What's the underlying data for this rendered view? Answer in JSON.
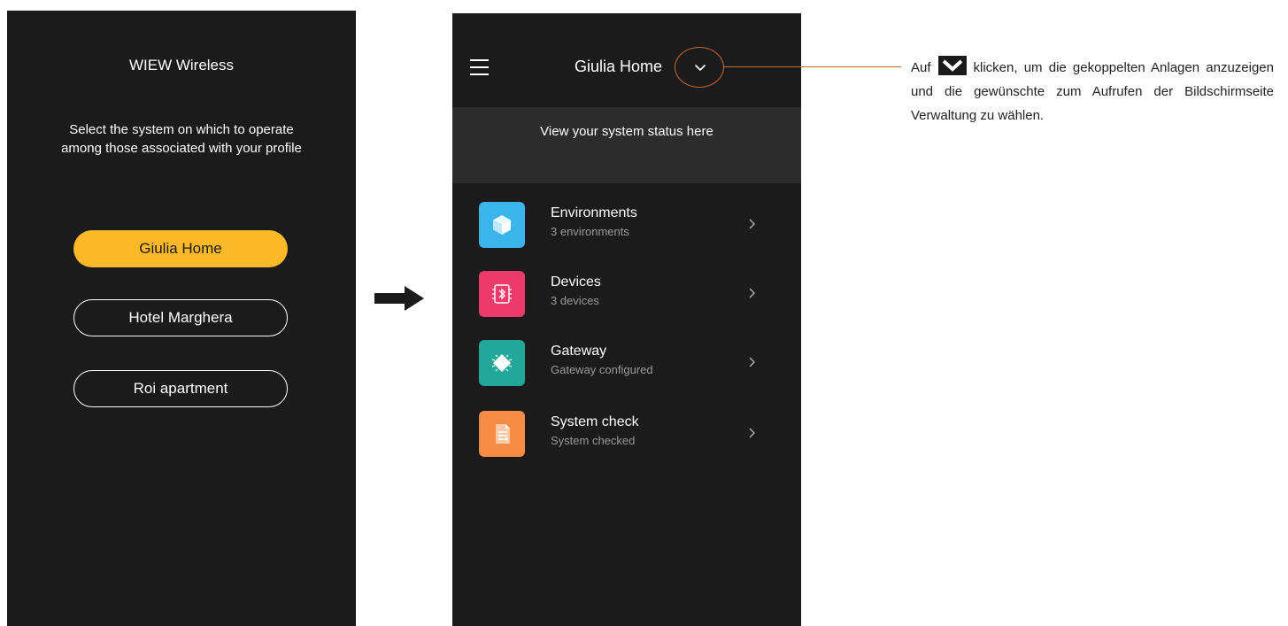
{
  "left_screen": {
    "title": "WIEW Wireless",
    "subtitle_line1": "Select the system on which to operate",
    "subtitle_line2": "among those associated with your profile",
    "systems": [
      {
        "label": "Giulia Home",
        "selected": true
      },
      {
        "label": "Hotel Marghera",
        "selected": false
      },
      {
        "label": "Roi apartment",
        "selected": false
      }
    ]
  },
  "right_screen": {
    "header": {
      "title": "Giulia Home",
      "menu_icon": "hamburger-icon",
      "dropdown_icon": "chevron-down-icon"
    },
    "status_text": "View your system status here",
    "items": [
      {
        "title": "Environments",
        "subtitle": "3 environments",
        "icon": "cube-icon",
        "color": "#3bb4ec"
      },
      {
        "title": "Devices",
        "subtitle": "3 devices",
        "icon": "bluetooth-chip-icon",
        "color": "#ec3b6b"
      },
      {
        "title": "Gateway",
        "subtitle": "Gateway configured",
        "icon": "gateway-chip-icon",
        "color": "#21a89a"
      },
      {
        "title": "System check",
        "subtitle": "System checked",
        "icon": "document-check-icon",
        "color": "#f78c45"
      }
    ]
  },
  "callout": {
    "text_before": "Auf",
    "text_after": "klicken, um die gekoppelten Anlagen anzuzeigen und die gewünschte zum Aufrufen der Bildschirmseite Verwaltung zu wählen.",
    "accent_color": "#c9692a",
    "icon": "chevron-down-icon"
  },
  "colors": {
    "phone_background": "#1b1b1b",
    "selected_button": "#fbb829",
    "status_band": "#2c2c2c"
  }
}
